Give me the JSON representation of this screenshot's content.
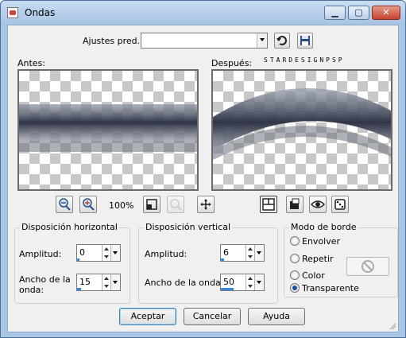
{
  "window": {
    "title": "Ondas"
  },
  "titlebar": {
    "min_symbol": "▁",
    "max_symbol": "▢",
    "close_symbol": "✕"
  },
  "presets": {
    "label": "Ajustes pred.:",
    "value": ""
  },
  "before": {
    "label": "Antes:"
  },
  "after": {
    "label": "Después:",
    "watermark": "STARDESIGNPSP"
  },
  "zoom": {
    "level": "100%"
  },
  "horizontal": {
    "title": "Disposición horizontal",
    "amplitude_label": "Amplitud:",
    "amplitude_value": "0",
    "amplitude_level": 0,
    "wavelength_label_1": "Ancho de la",
    "wavelength_label_2": "onda:",
    "wavelength_value": "15",
    "wavelength_level": 0.15
  },
  "vertical": {
    "title": "Disposición vertical",
    "amplitude_label": "Amplitud:",
    "amplitude_value": "6",
    "amplitude_level": 0.06,
    "wavelength_label": "Ancho de la onda:",
    "wavelength_value": "50",
    "wavelength_level": 0.5
  },
  "edge_mode": {
    "title": "Modo de borde",
    "options": [
      "Envolver",
      "Repetir",
      "Color",
      "Transparente"
    ],
    "selected": "Transparente",
    "color_swatch_icon": "no-color-icon"
  },
  "buttons": {
    "ok": "Aceptar",
    "cancel": "Cancelar",
    "help": "Ayuda"
  },
  "icons": [
    "app-icon",
    "save-icon",
    "reset-icon",
    "zoom-out-icon",
    "zoom-in-icon",
    "proportional-icon",
    "pan-icon",
    "hand-icon",
    "preview-toggle-icon",
    "randomize-icon",
    "eye-icon",
    "dice-icon"
  ]
}
